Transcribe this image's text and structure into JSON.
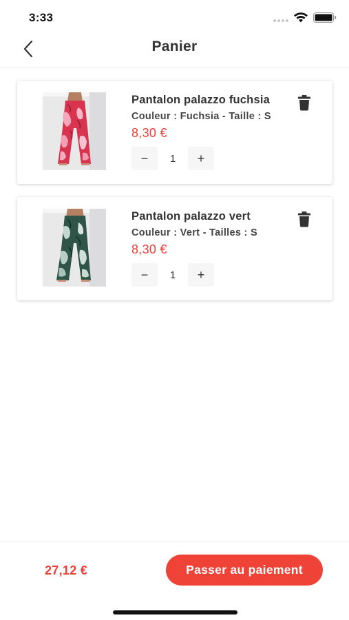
{
  "status_bar": {
    "time": "3:33",
    "icons": [
      "signal-dots-icon",
      "wifi-icon",
      "battery-icon"
    ]
  },
  "nav": {
    "back_icon": "chevron-left-icon",
    "title": "Panier"
  },
  "cart_items": [
    {
      "name": "Pantalon palazzo fuchsia",
      "variant": "Couleur : Fuchsia - Taille : S",
      "price": "8,30 €",
      "quantity": "1",
      "decrement_label": "−",
      "increment_label": "+",
      "delete_icon": "trash-icon",
      "image_colors": [
        "#e23b62",
        "#f2a3b8"
      ]
    },
    {
      "name": "Pantalon palazzo vert",
      "variant": "Couleur : Vert - Tailles : S",
      "price": "8,30 €",
      "quantity": "1",
      "decrement_label": "−",
      "increment_label": "+",
      "delete_icon": "trash-icon",
      "image_colors": [
        "#2f5448",
        "#bfd3cc"
      ]
    }
  ],
  "footer": {
    "total": "27,12 €",
    "checkout_label": "Passer au paiement"
  },
  "colors": {
    "accent": "#ef4338",
    "price": "#e8413b",
    "text": "#333333"
  }
}
